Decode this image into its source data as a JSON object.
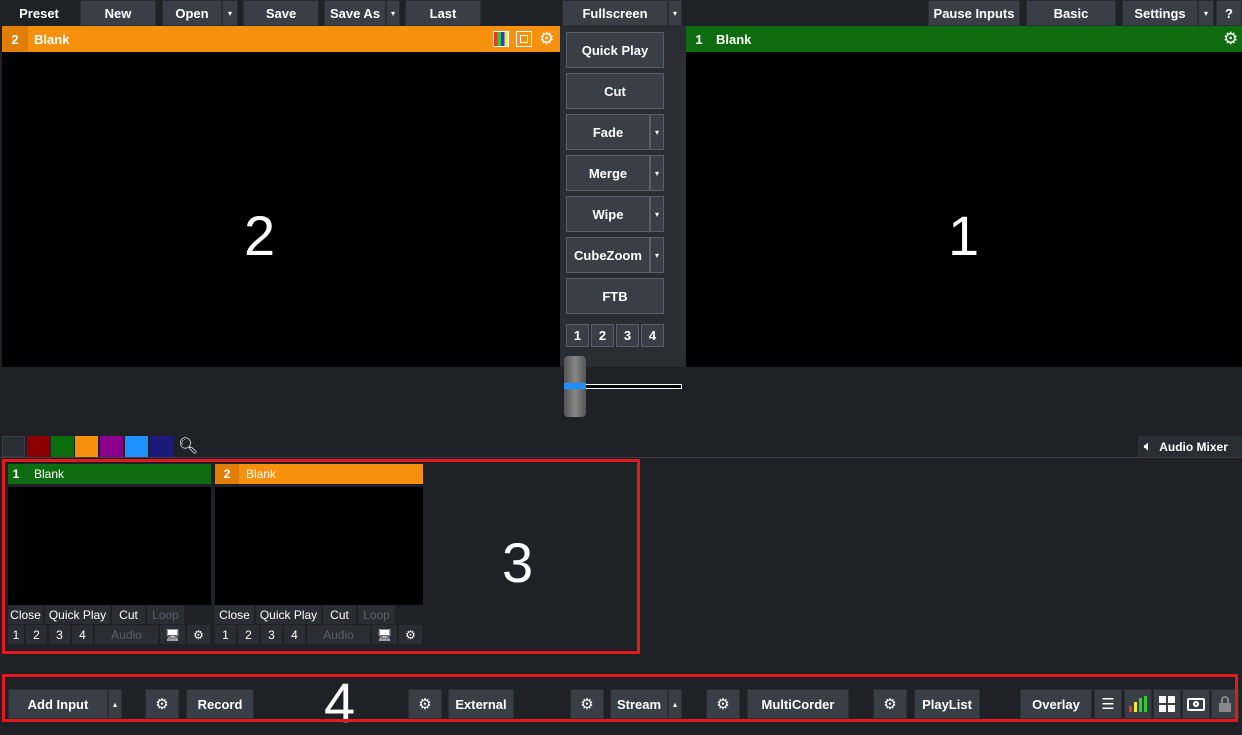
{
  "toolbar": {
    "preset": "Preset",
    "new": "New",
    "open": "Open",
    "save": "Save",
    "save_as": "Save As",
    "last": "Last",
    "fullscreen": "Fullscreen",
    "pause_inputs": "Pause Inputs",
    "basic": "Basic",
    "settings": "Settings",
    "help": "?"
  },
  "preview": {
    "number": "2",
    "title": "Blank",
    "color": "#f7900d"
  },
  "output": {
    "number": "1",
    "title": "Blank",
    "color": "#0f6b0f"
  },
  "transitions": {
    "quick_play": "Quick Play",
    "cut": "Cut",
    "fade": "Fade",
    "merge": "Merge",
    "wipe": "Wipe",
    "cubezoom": "CubeZoom",
    "ftb": "FTB",
    "numbers": [
      "1",
      "2",
      "3",
      "4"
    ]
  },
  "annotations": {
    "preview": "2",
    "output": "1",
    "inputs": "3",
    "bottom": "4"
  },
  "color_filters": [
    "#1f2127",
    "#8b0000",
    "#0a6e0a",
    "#f7900d",
    "#8b008b",
    "#1e90ff",
    "#1a1a7a"
  ],
  "audio_mixer": "Audio Mixer",
  "inputs": [
    {
      "number": "1",
      "title": "Blank",
      "color": "#0f6b0f",
      "text_color": "#ffffff",
      "close": "Close",
      "quick_play": "Quick Play",
      "cut": "Cut",
      "loop": "Loop",
      "nums": [
        "1",
        "2",
        "3",
        "4"
      ],
      "audio": "Audio"
    },
    {
      "number": "2",
      "title": "Blank",
      "color": "#f7900d",
      "text_color": "#ffffff",
      "close": "Close",
      "quick_play": "Quick Play",
      "cut": "Cut",
      "loop": "Loop",
      "nums": [
        "1",
        "2",
        "3",
        "4"
      ],
      "audio": "Audio"
    }
  ],
  "bottom": {
    "add_input": "Add Input",
    "record": "Record",
    "external": "External",
    "stream": "Stream",
    "multicorder": "MultiCorder",
    "playlist": "PlayList",
    "overlay": "Overlay"
  }
}
